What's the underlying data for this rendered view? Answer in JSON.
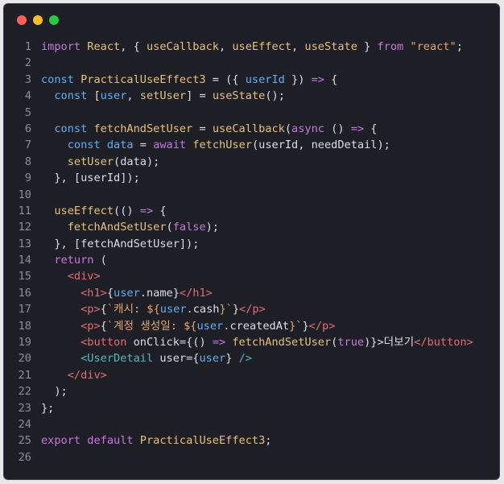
{
  "window": {
    "controls": [
      "close",
      "minimize",
      "maximize"
    ]
  },
  "lines": [
    {
      "n": "1",
      "tokens": [
        [
          "k",
          "import"
        ],
        [
          "p",
          " "
        ],
        [
          "f",
          "React"
        ],
        [
          "p",
          ", { "
        ],
        [
          "f",
          "useCallback"
        ],
        [
          "p",
          ", "
        ],
        [
          "f",
          "useEffect"
        ],
        [
          "p",
          ", "
        ],
        [
          "f",
          "useState"
        ],
        [
          "p",
          " } "
        ],
        [
          "k",
          "from"
        ],
        [
          "p",
          " "
        ],
        [
          "s",
          "\"react\""
        ],
        [
          "p",
          ";"
        ]
      ]
    },
    {
      "n": "2",
      "tokens": []
    },
    {
      "n": "3",
      "tokens": [
        [
          "v",
          "const"
        ],
        [
          "p",
          " "
        ],
        [
          "f",
          "PracticalUseEffect3"
        ],
        [
          "p",
          " = ({ "
        ],
        [
          "v",
          "userId"
        ],
        [
          "p",
          " }) "
        ],
        [
          "k",
          "=>"
        ],
        [
          "p",
          " {"
        ]
      ]
    },
    {
      "n": "4",
      "tokens": [
        [
          "p",
          "  "
        ],
        [
          "v",
          "const"
        ],
        [
          "p",
          " ["
        ],
        [
          "v",
          "user"
        ],
        [
          "p",
          ", "
        ],
        [
          "f",
          "setUser"
        ],
        [
          "p",
          "] = "
        ],
        [
          "f",
          "useState"
        ],
        [
          "p",
          "();"
        ]
      ]
    },
    {
      "n": "5",
      "tokens": []
    },
    {
      "n": "6",
      "tokens": [
        [
          "p",
          "  "
        ],
        [
          "v",
          "const"
        ],
        [
          "p",
          " "
        ],
        [
          "f",
          "fetchAndSetUser"
        ],
        [
          "p",
          " = "
        ],
        [
          "f",
          "useCallback"
        ],
        [
          "p",
          "("
        ],
        [
          "k",
          "async"
        ],
        [
          "p",
          " () "
        ],
        [
          "k",
          "=>"
        ],
        [
          "p",
          " {"
        ]
      ]
    },
    {
      "n": "7",
      "tokens": [
        [
          "p",
          "    "
        ],
        [
          "v",
          "const"
        ],
        [
          "p",
          " "
        ],
        [
          "v",
          "data"
        ],
        [
          "p",
          " = "
        ],
        [
          "k",
          "await"
        ],
        [
          "p",
          " "
        ],
        [
          "f",
          "fetchUser"
        ],
        [
          "p",
          "("
        ],
        [
          "p",
          "userId"
        ],
        [
          "p",
          ", "
        ],
        [
          "p",
          "needDetail"
        ],
        [
          "p",
          ");"
        ]
      ]
    },
    {
      "n": "8",
      "tokens": [
        [
          "p",
          "    "
        ],
        [
          "f",
          "setUser"
        ],
        [
          "p",
          "("
        ],
        [
          "p",
          "data"
        ],
        [
          "p",
          ");"
        ]
      ]
    },
    {
      "n": "9",
      "tokens": [
        [
          "p",
          "  }, ["
        ],
        [
          "p",
          "userId"
        ],
        [
          "p",
          "]);"
        ]
      ]
    },
    {
      "n": "10",
      "tokens": []
    },
    {
      "n": "11",
      "tokens": [
        [
          "p",
          "  "
        ],
        [
          "f",
          "useEffect"
        ],
        [
          "p",
          "(() "
        ],
        [
          "k",
          "=>"
        ],
        [
          "p",
          " {"
        ]
      ]
    },
    {
      "n": "12",
      "tokens": [
        [
          "p",
          "    "
        ],
        [
          "f",
          "fetchAndSetUser"
        ],
        [
          "p",
          "("
        ],
        [
          "k",
          "false"
        ],
        [
          "p",
          ");"
        ]
      ]
    },
    {
      "n": "13",
      "tokens": [
        [
          "p",
          "  }, ["
        ],
        [
          "p",
          "fetchAndSetUser"
        ],
        [
          "p",
          "]);"
        ]
      ]
    },
    {
      "n": "14",
      "tokens": [
        [
          "p",
          "  "
        ],
        [
          "k",
          "return"
        ],
        [
          "p",
          " ("
        ]
      ]
    },
    {
      "n": "15",
      "tokens": [
        [
          "p",
          "    "
        ],
        [
          "t",
          "<div>"
        ]
      ]
    },
    {
      "n": "16",
      "tokens": [
        [
          "p",
          "      "
        ],
        [
          "t",
          "<h1>"
        ],
        [
          "p",
          "{"
        ],
        [
          "v",
          "user"
        ],
        [
          "p",
          "."
        ],
        [
          "p",
          "name"
        ],
        [
          "p",
          "}"
        ],
        [
          "t",
          "</h1>"
        ]
      ]
    },
    {
      "n": "17",
      "tokens": [
        [
          "p",
          "      "
        ],
        [
          "t",
          "<p>"
        ],
        [
          "p",
          "{"
        ],
        [
          "s",
          "`캐시: ${"
        ],
        [
          "v",
          "user"
        ],
        [
          "p",
          "."
        ],
        [
          "p",
          "cash"
        ],
        [
          "s",
          "}`"
        ],
        [
          "p",
          "}"
        ],
        [
          "t",
          "</p>"
        ]
      ]
    },
    {
      "n": "18",
      "tokens": [
        [
          "p",
          "      "
        ],
        [
          "t",
          "<p>"
        ],
        [
          "p",
          "{"
        ],
        [
          "s",
          "`계정 생성일: ${"
        ],
        [
          "v",
          "user"
        ],
        [
          "p",
          "."
        ],
        [
          "p",
          "createdAt"
        ],
        [
          "s",
          "}`"
        ],
        [
          "p",
          "}"
        ],
        [
          "t",
          "</p>"
        ]
      ]
    },
    {
      "n": "19",
      "tokens": [
        [
          "p",
          "      "
        ],
        [
          "t",
          "<button"
        ],
        [
          "p",
          " "
        ],
        [
          "p",
          "onClick"
        ],
        [
          "p",
          "={() "
        ],
        [
          "k",
          "=>"
        ],
        [
          "p",
          " "
        ],
        [
          "f",
          "fetchAndSetUser"
        ],
        [
          "p",
          "("
        ],
        [
          "k",
          "true"
        ],
        [
          "p",
          ")}>"
        ],
        [
          "p",
          "더보기"
        ],
        [
          "t",
          "</button>"
        ]
      ]
    },
    {
      "n": "20",
      "tokens": [
        [
          "p",
          "      "
        ],
        [
          "c",
          "<UserDetail"
        ],
        [
          "p",
          " "
        ],
        [
          "p",
          "user"
        ],
        [
          "p",
          "={"
        ],
        [
          "v",
          "user"
        ],
        [
          "p",
          "} "
        ],
        [
          "c",
          "/>"
        ]
      ]
    },
    {
      "n": "21",
      "tokens": [
        [
          "p",
          "    "
        ],
        [
          "t",
          "</div>"
        ]
      ]
    },
    {
      "n": "22",
      "tokens": [
        [
          "p",
          "  );"
        ]
      ]
    },
    {
      "n": "23",
      "tokens": [
        [
          "p",
          "};"
        ]
      ]
    },
    {
      "n": "24",
      "tokens": []
    },
    {
      "n": "25",
      "tokens": [
        [
          "k",
          "export"
        ],
        [
          "p",
          " "
        ],
        [
          "k",
          "default"
        ],
        [
          "p",
          " "
        ],
        [
          "f",
          "PracticalUseEffect3"
        ],
        [
          "p",
          ";"
        ]
      ]
    },
    {
      "n": "26",
      "tokens": []
    }
  ]
}
